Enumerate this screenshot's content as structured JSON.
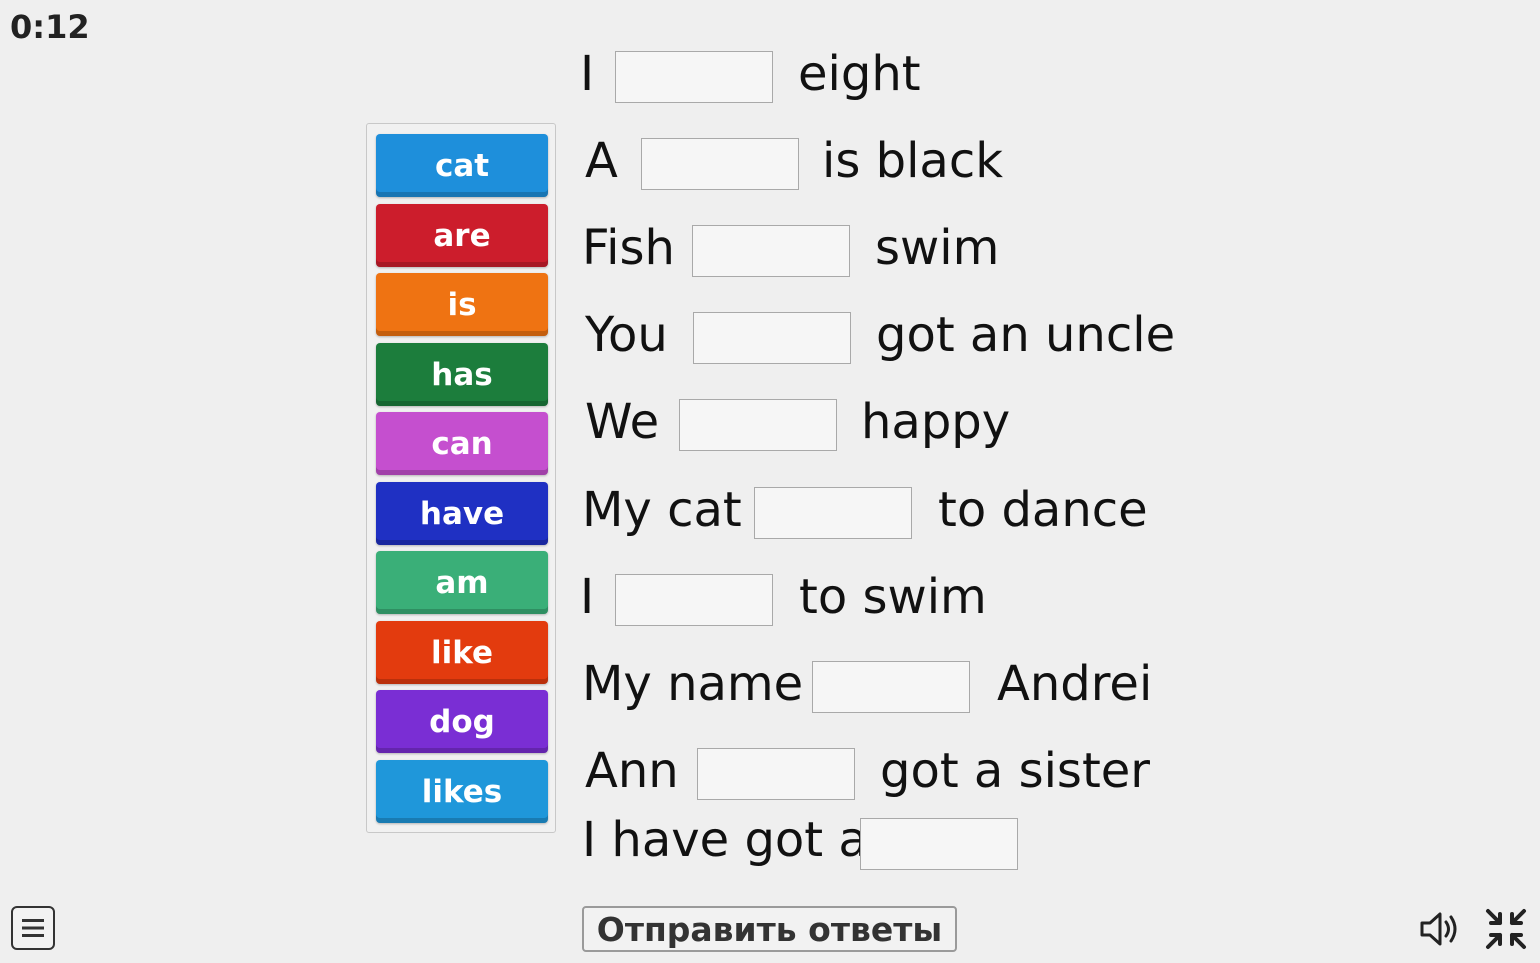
{
  "timer": "0:12",
  "word_bank": [
    {
      "label": "cat",
      "color": "#1e8fdb"
    },
    {
      "label": "are",
      "color": "#cc1d2c"
    },
    {
      "label": "is",
      "color": "#ef7312"
    },
    {
      "label": "has",
      "color": "#1c7d3c"
    },
    {
      "label": "can",
      "color": "#c54fcf"
    },
    {
      "label": "have",
      "color": "#1f30c3"
    },
    {
      "label": "am",
      "color": "#3aaf78"
    },
    {
      "label": "like",
      "color": "#e33b0e"
    },
    {
      "label": "dog",
      "color": "#7a2ed4"
    },
    {
      "label": "likes",
      "color": "#1f97da"
    }
  ],
  "sentences": [
    {
      "before": "I",
      "after": "eight"
    },
    {
      "before": "A",
      "after": "is black"
    },
    {
      "before": "Fish",
      "after": "swim"
    },
    {
      "before": "You",
      "after": "got an uncle"
    },
    {
      "before": "We",
      "after": "happy"
    },
    {
      "before": "My cat",
      "after": "to dance"
    },
    {
      "before": "I",
      "after": "to swim"
    },
    {
      "before": "My name",
      "after": "Andrei"
    },
    {
      "before": "Ann",
      "after": "got a sister"
    },
    {
      "before": "I have got a",
      "after": ""
    }
  ],
  "submit_label": "Отправить ответы",
  "icons": {
    "menu": "menu-icon",
    "volume": "volume-icon",
    "exit_fullscreen": "exit-fullscreen-icon"
  }
}
